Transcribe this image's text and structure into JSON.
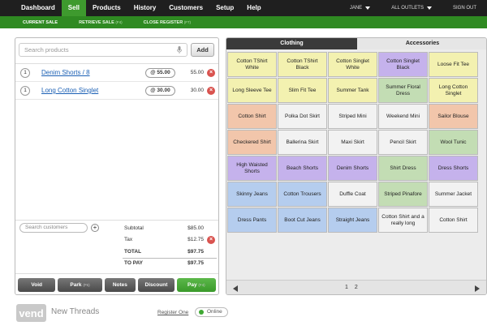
{
  "nav": {
    "items": [
      "Dashboard",
      "Sell",
      "Products",
      "History",
      "Customers",
      "Setup",
      "Help"
    ],
    "active": "Sell",
    "user": "JANE",
    "outlets": "ALL OUTLETS",
    "signout": "SIGN OUT"
  },
  "subnav": {
    "current_sale": "CURRENT SALE",
    "retrieve_sale": "RETRIEVE SALE",
    "retrieve_shortcut": "(F4)",
    "close_register": "CLOSE REGISTER",
    "close_shortcut": "(F7)"
  },
  "sale": {
    "search_placeholder": "Search products",
    "add_label": "Add",
    "lines": [
      {
        "qty": "1",
        "name": "Denim Shorts / 8",
        "price": "@ 55.00",
        "total": "55.00"
      },
      {
        "qty": "1",
        "name": "Long Cotton Singlet",
        "price": "@ 30.00",
        "total": "30.00"
      }
    ],
    "customer_placeholder": "Search customers",
    "plus": "+",
    "subtotal_label": "Subtotal",
    "subtotal": "$85.00",
    "tax_label": "Tax",
    "tax": "$12.75",
    "total_label": "TOTAL",
    "total": "$97.75",
    "topay_label": "TO PAY",
    "topay": "$97.75",
    "remove": "×"
  },
  "actions": {
    "void": "Void",
    "park": "Park",
    "park_shortcut": "(F5)",
    "notes": "Notes",
    "discount": "Discount",
    "pay": "Pay",
    "pay_shortcut": "(F4)"
  },
  "quickkeys": {
    "tabs": [
      "Clothing",
      "Accessories"
    ],
    "active_tab": "Clothing",
    "tiles": [
      {
        "label": "Cotton TShirt White",
        "color": "yellow"
      },
      {
        "label": "Cotton TShirt Black",
        "color": "yellow"
      },
      {
        "label": "Cotton Singlet White",
        "color": "yellow"
      },
      {
        "label": "Cotton Singlet Black",
        "color": "purple"
      },
      {
        "label": "Loose Fit Tee",
        "color": "yellow"
      },
      {
        "label": "Long Sleeve Tee",
        "color": "yellow"
      },
      {
        "label": "Slim Fit Tee",
        "color": "yellow"
      },
      {
        "label": "Summer Tank",
        "color": "yellow"
      },
      {
        "label": "Summer Floral Dress",
        "color": "green"
      },
      {
        "label": "Long Cotton Singlet",
        "color": "yellow"
      },
      {
        "label": "Cotton Shirt",
        "color": "orange"
      },
      {
        "label": "Polka Dot Skirt",
        "color": "white"
      },
      {
        "label": "Striped Mini",
        "color": "white"
      },
      {
        "label": "Weekend Mini",
        "color": "white"
      },
      {
        "label": "Sailor Blouse",
        "color": "orange"
      },
      {
        "label": "Checkered Shirt",
        "color": "orange"
      },
      {
        "label": "Ballerina Skirt",
        "color": "white"
      },
      {
        "label": "Maxi Skirt",
        "color": "white"
      },
      {
        "label": "Pencil Skirt",
        "color": "white"
      },
      {
        "label": "Wool Tunic",
        "color": "green"
      },
      {
        "label": "High Waisted Shorts",
        "color": "purple"
      },
      {
        "label": "Beach Shorts",
        "color": "purple"
      },
      {
        "label": "Denim Shorts",
        "color": "purple"
      },
      {
        "label": "Shirt Dress",
        "color": "green"
      },
      {
        "label": "Dress Shorts",
        "color": "purple"
      },
      {
        "label": "Skinny Jeans",
        "color": "blue"
      },
      {
        "label": "Cotton Trousers",
        "color": "blue"
      },
      {
        "label": "Duffle Coat",
        "color": "white"
      },
      {
        "label": "Striped Pinafore",
        "color": "green"
      },
      {
        "label": "Summer Jacket",
        "color": "white"
      },
      {
        "label": "Dress Pants",
        "color": "blue"
      },
      {
        "label": "Boot Cut Jeans",
        "color": "blue"
      },
      {
        "label": "Straight Jeans",
        "color": "blue"
      },
      {
        "label": "Cotton Shirt and a really long",
        "color": "white"
      },
      {
        "label": "Cotton Shirt",
        "color": "white"
      }
    ],
    "pages": [
      "1",
      "2"
    ],
    "current_page": "1"
  },
  "footer": {
    "logo": "vend",
    "store": "New Threads",
    "register": "Register One",
    "status": "Online",
    "status_color": "#3fa833"
  },
  "colors": {
    "nav_bg": "#1f1f1f",
    "accent": "#3e9a2e",
    "subnav_bg": "#2f8a22",
    "remove": "#d9534f"
  }
}
